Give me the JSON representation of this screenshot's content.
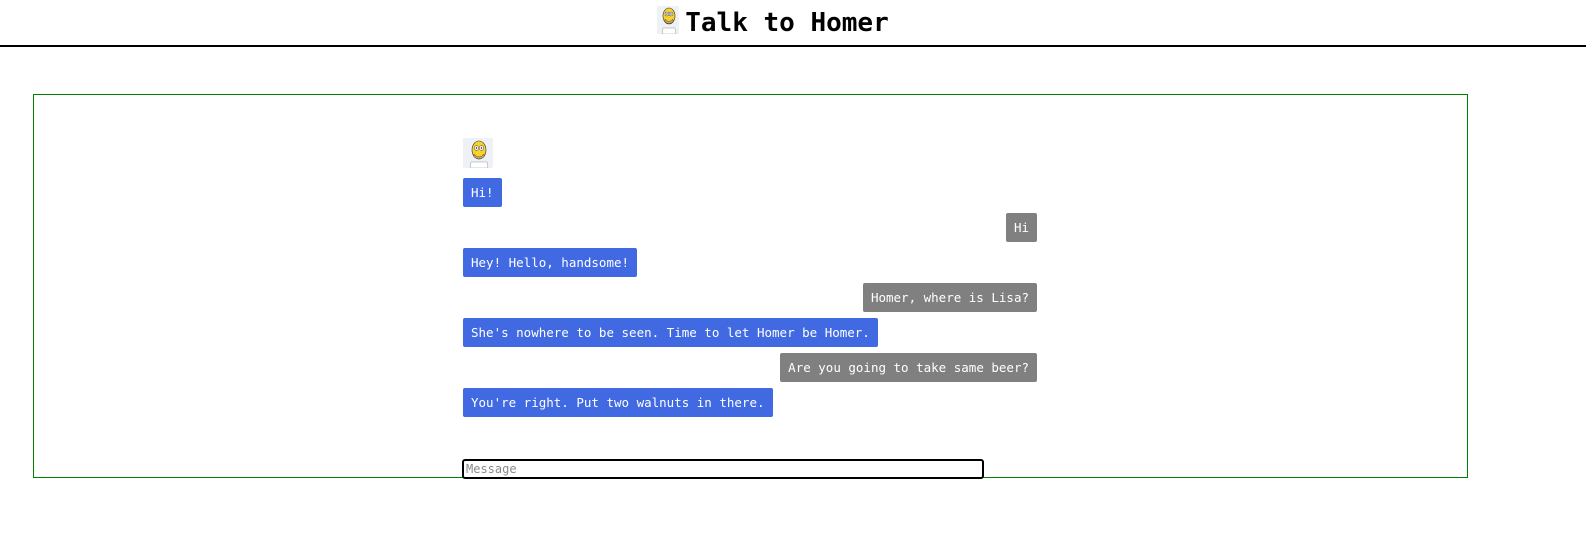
{
  "header": {
    "title": "Talk to Homer",
    "avatar_icon": "homer-avatar-icon"
  },
  "chat": {
    "bot_avatar_icon": "homer-avatar-icon",
    "bot_color": "#4169e1",
    "user_color": "#808080",
    "frame_color": "#008000",
    "messages": [
      {
        "from": "bot",
        "text": "Hi!"
      },
      {
        "from": "user",
        "text": "Hi"
      },
      {
        "from": "bot",
        "text": "Hey! Hello, handsome!"
      },
      {
        "from": "user",
        "text": "Homer, where is Lisa?"
      },
      {
        "from": "bot",
        "text": "She's nowhere to be seen. Time to let Homer be Homer."
      },
      {
        "from": "user",
        "text": "Are you going to take same beer?"
      },
      {
        "from": "bot",
        "text": "You're right. Put two walnuts in there."
      }
    ]
  },
  "input": {
    "placeholder": "Message",
    "value": ""
  }
}
